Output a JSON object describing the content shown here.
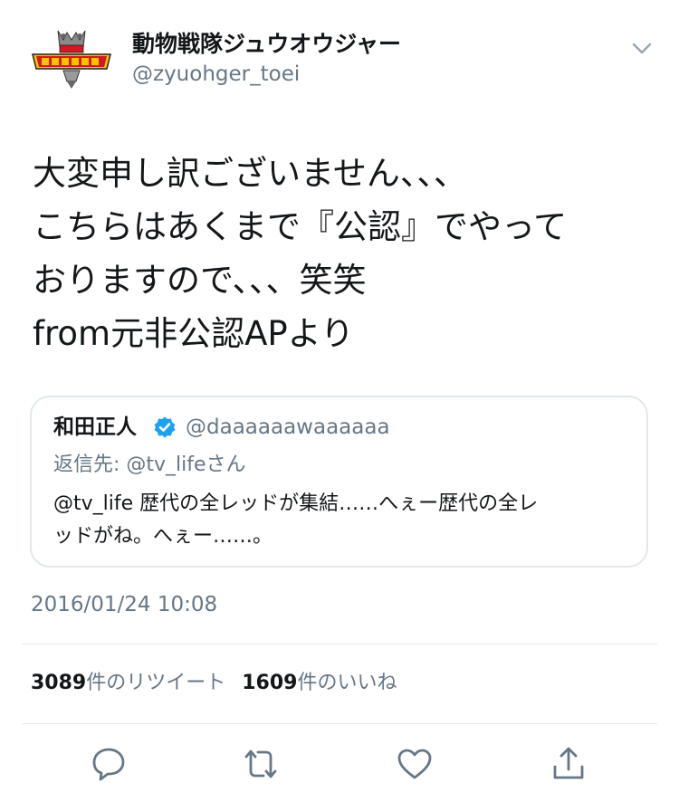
{
  "author": {
    "display_name": "動物戦隊ジュウオウジャー",
    "handle": "@zyuohger_toei",
    "avatar_logo_text": "動物戦隊ジュウオウジャー"
  },
  "tweet": {
    "lines": [
      "大変申し訳ございません、、、",
      "こちらはあくまで『公認』でやって",
      "おりますので、、、笑笑",
      "from元非公認APより"
    ],
    "timestamp": "2016/01/24 10:08"
  },
  "quoted_tweet": {
    "name": "和田正人",
    "handle": "@daaaaaawaaaaaa",
    "reply_to": "返信先: @tv_lifeさん",
    "lines": [
      "@tv_life 歴代の全レッドが集結……へぇー歴代の全レ",
      "ッドがね。へぇー……。"
    ]
  },
  "stats": {
    "retweet_count": "3089",
    "retweet_label": "件のリツイート",
    "like_count": "1609",
    "like_label": "件のいいね"
  },
  "icons": {
    "chevron": "chevron-down-icon",
    "verified": "verified-badge-icon",
    "reply": "reply-icon",
    "retweet": "retweet-icon",
    "like": "heart-icon",
    "share": "share-icon"
  },
  "colors": {
    "text": "#14171a",
    "secondary": "#657786",
    "border": "#e1e8ed",
    "verified": "#1da1f2",
    "logo_red": "#d4181f",
    "logo_yellow": "#f5c400"
  }
}
